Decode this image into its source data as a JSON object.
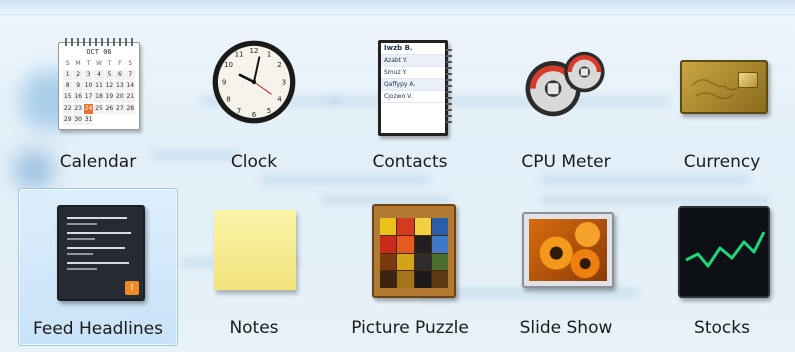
{
  "gadgets": [
    {
      "id": "calendar",
      "label": "Calendar"
    },
    {
      "id": "clock",
      "label": "Clock"
    },
    {
      "id": "contacts",
      "label": "Contacts"
    },
    {
      "id": "cpu-meter",
      "label": "CPU Meter"
    },
    {
      "id": "currency",
      "label": "Currency"
    },
    {
      "id": "feed-headlines",
      "label": "Feed Headlines",
      "selected": true
    },
    {
      "id": "notes",
      "label": "Notes"
    },
    {
      "id": "picture-puzzle",
      "label": "Picture Puzzle"
    },
    {
      "id": "slide-show",
      "label": "Slide Show"
    },
    {
      "id": "stocks",
      "label": "Stocks"
    }
  ],
  "calendar_icon": {
    "month": "OCT 06",
    "weekdays": [
      "S",
      "M",
      "T",
      "W",
      "T",
      "F",
      "S"
    ],
    "days": [
      "1",
      "2",
      "3",
      "4",
      "5",
      "6",
      "7",
      "8",
      "9",
      "10",
      "11",
      "12",
      "13",
      "14",
      "15",
      "16",
      "17",
      "18",
      "19",
      "20",
      "21",
      "22",
      "23",
      "24",
      "25",
      "26",
      "27",
      "28",
      "29",
      "30",
      "31"
    ],
    "today": "24"
  },
  "contacts_icon": {
    "names": [
      "Iwzb B.",
      "Azabt Y.",
      "Smuz Y.",
      "Qaffypy A.",
      "Cjozwo V."
    ]
  },
  "colors": {
    "selection": "#c4e0f8",
    "selection_border": "#9cc5ea",
    "calendar_today": "#e8722c",
    "stocks_line": "#1fd67a"
  }
}
